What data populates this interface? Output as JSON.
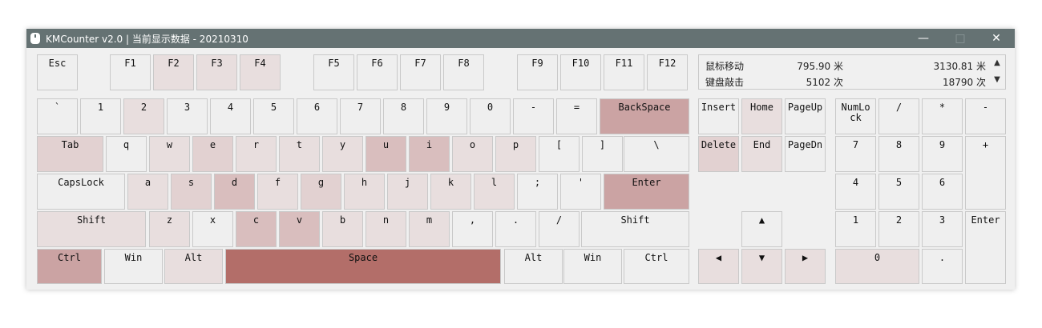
{
  "window": {
    "title": "KMCounter v2.0 | 当前显示数据 - 20210310",
    "controls": {
      "minimize": "—",
      "maximize": "□",
      "close": "✕"
    }
  },
  "stats": {
    "mouse_label": "鼠标移动",
    "mouse_value_1": "795.90 米",
    "mouse_value_2": "3130.81 米",
    "keys_label": "键盘敲击",
    "keys_value_1": "5102 次",
    "keys_value_2": "18790 次",
    "scroll_up": "▲",
    "scroll_down": "▼"
  },
  "heat_colors": [
    "#efefef",
    "#e8dede",
    "#e2d1d1",
    "#d9bebe",
    "#cba3a3",
    "#b36e69"
  ],
  "keys": [
    {
      "id": "esc",
      "label": "Esc",
      "heat": 0
    },
    {
      "id": "f1",
      "label": "F1",
      "heat": 0
    },
    {
      "id": "f2",
      "label": "F2",
      "heat": 1
    },
    {
      "id": "f3",
      "label": "F3",
      "heat": 1
    },
    {
      "id": "f4",
      "label": "F4",
      "heat": 1
    },
    {
      "id": "f5",
      "label": "F5",
      "heat": 0
    },
    {
      "id": "f6",
      "label": "F6",
      "heat": 0
    },
    {
      "id": "f7",
      "label": "F7",
      "heat": 0
    },
    {
      "id": "f8",
      "label": "F8",
      "heat": 0
    },
    {
      "id": "f9",
      "label": "F9",
      "heat": 0
    },
    {
      "id": "f10",
      "label": "F10",
      "heat": 0
    },
    {
      "id": "f11",
      "label": "F11",
      "heat": 0
    },
    {
      "id": "f12",
      "label": "F12",
      "heat": 0
    },
    {
      "id": "backtick",
      "label": "`",
      "heat": 0
    },
    {
      "id": "1",
      "label": "1",
      "heat": 0
    },
    {
      "id": "2",
      "label": "2",
      "heat": 1
    },
    {
      "id": "3",
      "label": "3",
      "heat": 0
    },
    {
      "id": "4",
      "label": "4",
      "heat": 0
    },
    {
      "id": "5",
      "label": "5",
      "heat": 0
    },
    {
      "id": "6",
      "label": "6",
      "heat": 0
    },
    {
      "id": "7",
      "label": "7",
      "heat": 0
    },
    {
      "id": "8",
      "label": "8",
      "heat": 0
    },
    {
      "id": "9",
      "label": "9",
      "heat": 0
    },
    {
      "id": "0",
      "label": "0",
      "heat": 0
    },
    {
      "id": "minus",
      "label": "-",
      "heat": 0
    },
    {
      "id": "equal",
      "label": "=",
      "heat": 0
    },
    {
      "id": "backspace",
      "label": "BackSpace",
      "heat": 4
    },
    {
      "id": "insert",
      "label": "Insert",
      "heat": 0
    },
    {
      "id": "home",
      "label": "Home",
      "heat": 1
    },
    {
      "id": "pageup",
      "label": "PageUp",
      "heat": 0
    },
    {
      "id": "numlock",
      "label": "NumLo ck",
      "heat": 0
    },
    {
      "id": "np-slash",
      "label": "/",
      "heat": 0
    },
    {
      "id": "np-star",
      "label": "*",
      "heat": 0
    },
    {
      "id": "np-minus",
      "label": "-",
      "heat": 0
    },
    {
      "id": "tab",
      "label": "Tab",
      "heat": 2
    },
    {
      "id": "q",
      "label": "q",
      "heat": 0
    },
    {
      "id": "w",
      "label": "w",
      "heat": 1
    },
    {
      "id": "e",
      "label": "e",
      "heat": 2
    },
    {
      "id": "r",
      "label": "r",
      "heat": 1
    },
    {
      "id": "t",
      "label": "t",
      "heat": 1
    },
    {
      "id": "y",
      "label": "y",
      "heat": 1
    },
    {
      "id": "u",
      "label": "u",
      "heat": 3
    },
    {
      "id": "i",
      "label": "i",
      "heat": 3
    },
    {
      "id": "o",
      "label": "o",
      "heat": 1
    },
    {
      "id": "p",
      "label": "p",
      "heat": 1
    },
    {
      "id": "lbracket",
      "label": "[",
      "heat": 0
    },
    {
      "id": "rbracket",
      "label": "]",
      "heat": 0
    },
    {
      "id": "backslash",
      "label": "\\",
      "heat": 0
    },
    {
      "id": "delete",
      "label": "Delete",
      "heat": 2
    },
    {
      "id": "end",
      "label": "End",
      "heat": 1
    },
    {
      "id": "pagedn",
      "label": "PageDn",
      "heat": 0
    },
    {
      "id": "np7",
      "label": "7",
      "heat": 0
    },
    {
      "id": "np8",
      "label": "8",
      "heat": 0
    },
    {
      "id": "np9",
      "label": "9",
      "heat": 0
    },
    {
      "id": "np-plus",
      "label": "+",
      "heat": 0
    },
    {
      "id": "capslock",
      "label": "CapsLock",
      "heat": 0
    },
    {
      "id": "a",
      "label": "a",
      "heat": 1
    },
    {
      "id": "s",
      "label": "s",
      "heat": 2
    },
    {
      "id": "d",
      "label": "d",
      "heat": 3
    },
    {
      "id": "f",
      "label": "f",
      "heat": 1
    },
    {
      "id": "g",
      "label": "g",
      "heat": 2
    },
    {
      "id": "h",
      "label": "h",
      "heat": 1
    },
    {
      "id": "j",
      "label": "j",
      "heat": 1
    },
    {
      "id": "k",
      "label": "k",
      "heat": 1
    },
    {
      "id": "l",
      "label": "l",
      "heat": 1
    },
    {
      "id": "semicolon",
      "label": ";",
      "heat": 0
    },
    {
      "id": "quote",
      "label": "'",
      "heat": 0
    },
    {
      "id": "enter",
      "label": "Enter",
      "heat": 4
    },
    {
      "id": "np4",
      "label": "4",
      "heat": 0
    },
    {
      "id": "np5",
      "label": "5",
      "heat": 0
    },
    {
      "id": "np6",
      "label": "6",
      "heat": 0
    },
    {
      "id": "lshift",
      "label": "Shift",
      "heat": 1
    },
    {
      "id": "z",
      "label": "z",
      "heat": 1
    },
    {
      "id": "x",
      "label": "x",
      "heat": 0
    },
    {
      "id": "c",
      "label": "c",
      "heat": 3
    },
    {
      "id": "v",
      "label": "v",
      "heat": 3
    },
    {
      "id": "b",
      "label": "b",
      "heat": 1
    },
    {
      "id": "n",
      "label": "n",
      "heat": 1
    },
    {
      "id": "m",
      "label": "m",
      "heat": 1
    },
    {
      "id": "comma",
      "label": ",",
      "heat": 0
    },
    {
      "id": "period",
      "label": ".",
      "heat": 0
    },
    {
      "id": "slash",
      "label": "/",
      "heat": 0
    },
    {
      "id": "rshift",
      "label": "Shift",
      "heat": 0
    },
    {
      "id": "up",
      "label": "▲",
      "heat": 0
    },
    {
      "id": "np1",
      "label": "1",
      "heat": 0
    },
    {
      "id": "np2",
      "label": "2",
      "heat": 0
    },
    {
      "id": "np3",
      "label": "3",
      "heat": 0
    },
    {
      "id": "np-enter",
      "label": "Enter",
      "heat": 0
    },
    {
      "id": "lctrl",
      "label": "Ctrl",
      "heat": 4
    },
    {
      "id": "lwin",
      "label": "Win",
      "heat": 0
    },
    {
      "id": "lalt",
      "label": "Alt",
      "heat": 1
    },
    {
      "id": "space",
      "label": "Space",
      "heat": 5
    },
    {
      "id": "ralt",
      "label": "Alt",
      "heat": 0
    },
    {
      "id": "rwin",
      "label": "Win",
      "heat": 0
    },
    {
      "id": "rctrl",
      "label": "Ctrl",
      "heat": 0
    },
    {
      "id": "left",
      "label": "◀",
      "heat": 1
    },
    {
      "id": "down",
      "label": "▼",
      "heat": 1
    },
    {
      "id": "right",
      "label": "▶",
      "heat": 1
    },
    {
      "id": "np0",
      "label": "0",
      "heat": 1
    },
    {
      "id": "np-dot",
      "label": ".",
      "heat": 0
    }
  ]
}
